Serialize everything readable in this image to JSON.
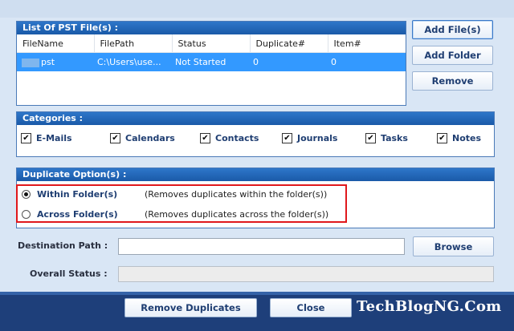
{
  "pst_list": {
    "header": "List Of PST File(s) :",
    "columns": [
      "FileName",
      "FilePath",
      "Status",
      "Duplicate#",
      "Item#"
    ],
    "rows": [
      {
        "filename": "pst",
        "filepath": "C:\\Users\\use...",
        "status": "Not Started",
        "duplicate": "0",
        "item": "0"
      }
    ]
  },
  "side_buttons": {
    "add_files": "Add File(s)",
    "add_folder": "Add Folder",
    "remove": "Remove"
  },
  "categories": {
    "header": "Categories :",
    "items": [
      {
        "label": "E-Mails",
        "checked": true
      },
      {
        "label": "Calendars",
        "checked": true
      },
      {
        "label": "Contacts",
        "checked": true
      },
      {
        "label": "Journals",
        "checked": true
      },
      {
        "label": "Tasks",
        "checked": true
      },
      {
        "label": "Notes",
        "checked": true
      }
    ]
  },
  "duplicate_options": {
    "header": "Duplicate Option(s) :",
    "options": [
      {
        "label": "Within Folder(s)",
        "description": "(Removes duplicates within the folder(s))",
        "selected": true
      },
      {
        "label": "Across Folder(s)",
        "description": "(Removes duplicates across the folder(s))",
        "selected": false
      }
    ],
    "highlight_color": "#e0181c"
  },
  "destination": {
    "label": "Destination Path :",
    "value": "",
    "browse_label": "Browse"
  },
  "overall_status": {
    "label": "Overall Status :",
    "value": ""
  },
  "footer": {
    "remove_duplicates": "Remove Duplicates",
    "close": "Close",
    "watermark": "TechBlogNG.Com"
  },
  "colors": {
    "header_blue": "#1a5aa8",
    "selected_row": "#3399ff",
    "footer_bg": "#1e3f7a"
  }
}
